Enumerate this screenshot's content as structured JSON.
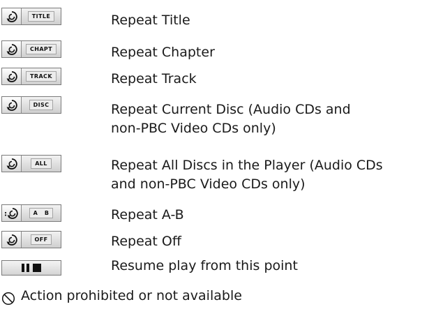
{
  "items": [
    {
      "tag": "TITLE",
      "icon": "repeat-icon",
      "lines": [
        "Repeat Title"
      ]
    },
    {
      "tag": "CHAPT",
      "icon": "repeat-icon",
      "lines": [
        "Repeat Chapter"
      ]
    },
    {
      "tag": "TRACK",
      "icon": "repeat-icon",
      "lines": [
        "Repeat Track"
      ]
    },
    {
      "tag": "DISC",
      "icon": "repeat-icon",
      "lines": [
        "Repeat Current Disc (Audio CDs and",
        "non-PBC Video CDs only)"
      ]
    },
    {
      "tag": "ALL",
      "icon": "repeat-icon",
      "lines": [
        "Repeat All Discs in the Player (Audio CDs",
        "and non-PBC Video CDs only)"
      ]
    },
    {
      "tag": "A   B",
      "icon": "repeat-ab-icon",
      "lines": [
        "Repeat A-B"
      ]
    },
    {
      "tag": "OFF",
      "icon": "repeat-icon",
      "lines": [
        "Repeat Off"
      ]
    },
    {
      "tag": "",
      "icon": "pause-stop-icon",
      "lines": [
        "Resume play from this point"
      ]
    }
  ],
  "prohibited": {
    "icon": "prohibited-icon",
    "text": "Action prohibited or not available"
  }
}
